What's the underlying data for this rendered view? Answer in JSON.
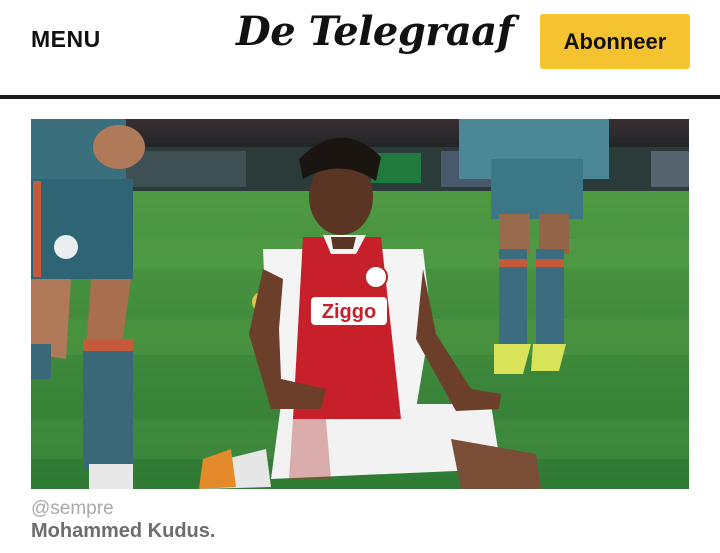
{
  "header": {
    "menu_label": "MENU",
    "logo_text": "De Telegraaf",
    "subscribe_label": "Abonneer",
    "accent_color": "#f5c230"
  },
  "article": {
    "image_credit": "@sempre",
    "caption": "Mohammed Kudus.",
    "shirt_sponsor": "Ziggo"
  }
}
